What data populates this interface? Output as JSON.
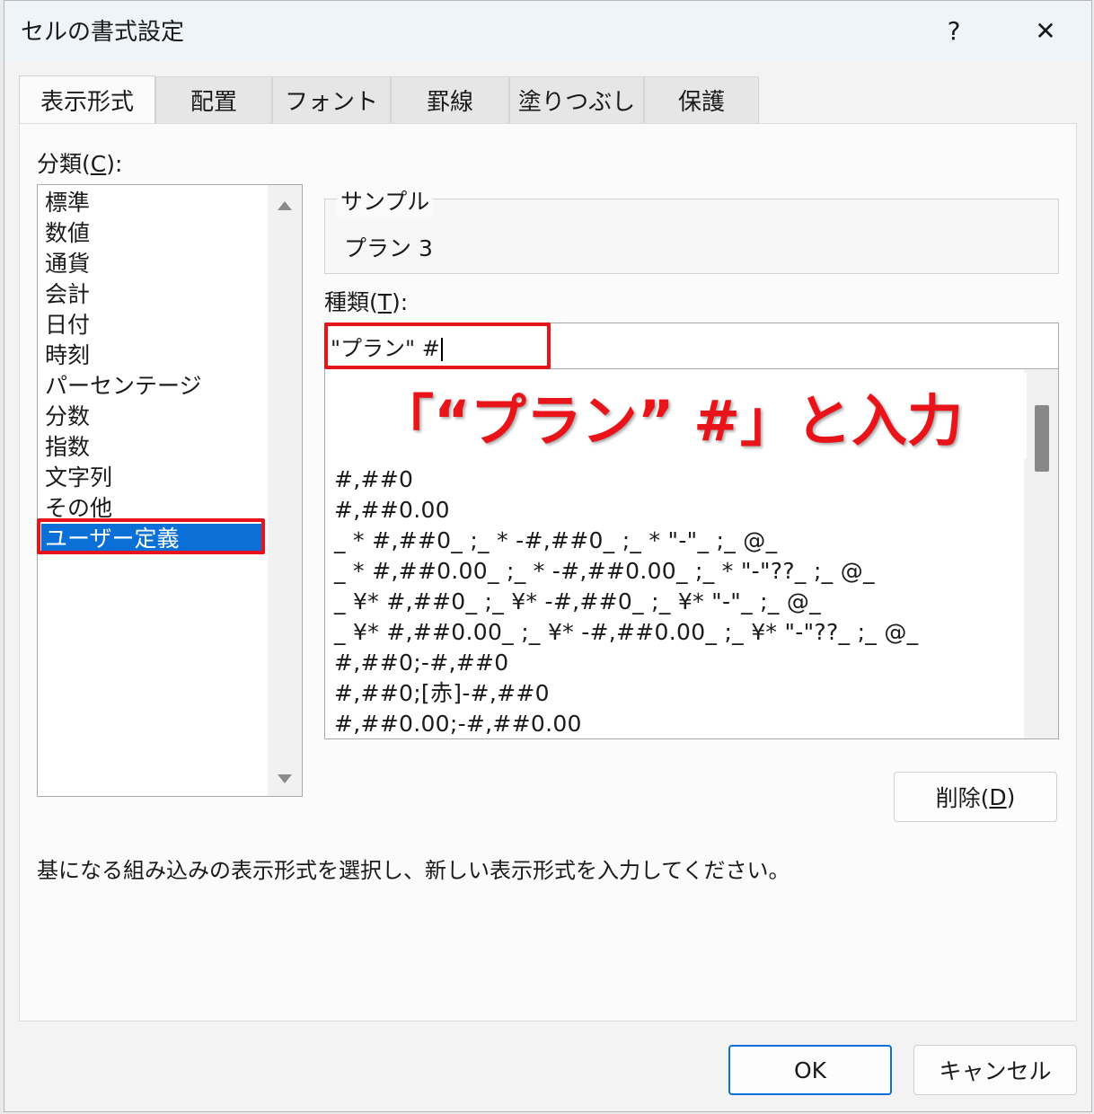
{
  "window": {
    "title": "セルの書式設定",
    "help": "?",
    "close": "✕"
  },
  "tabs": [
    {
      "label": "表示形式",
      "active": true
    },
    {
      "label": "配置"
    },
    {
      "label": "フォント"
    },
    {
      "label": "罫線"
    },
    {
      "label": "塗りつぶし"
    },
    {
      "label": "保護"
    }
  ],
  "category": {
    "label": "分類(",
    "accel": "C",
    "label_end": "):",
    "items": [
      "標準",
      "数値",
      "通貨",
      "会計",
      "日付",
      "時刻",
      "パーセンテージ",
      "分数",
      "指数",
      "文字列",
      "その他",
      "ユーザー定義"
    ],
    "selected": "ユーザー定義"
  },
  "sample": {
    "legend": "サンプル",
    "value": "プラン 3"
  },
  "type": {
    "label": "種類(",
    "accel": "T",
    "label_end": "):",
    "value": "\"プラン\" #",
    "formats": [
      "#,##0",
      "#,##0.00",
      "_ * #,##0_ ;_ * -#,##0_ ;_ * \"-\"_ ;_ @_",
      "_ * #,##0.00_ ;_ * -#,##0.00_ ;_ * \"-\"??_ ;_ @_",
      "_ ¥* #,##0_ ;_ ¥* -#,##0_ ;_ ¥* \"-\"_ ;_ @_",
      "_ ¥* #,##0.00_ ;_ ¥* -#,##0.00_ ;_ ¥* \"-\"??_ ;_ @_",
      "#,##0;-#,##0",
      "#,##0;[赤]-#,##0",
      "#,##0.00;-#,##0.00"
    ]
  },
  "annotation": "「“プラン” #」と入力",
  "buttons": {
    "delete": "削除(",
    "delete_accel": "D",
    "delete_end": ")",
    "ok": "OK",
    "cancel": "キャンセル"
  },
  "description": "基になる組み込みの表示形式を選択し、新しい表示形式を入力してください。",
  "colors": {
    "highlight": "#e8141a",
    "selection": "#0b6fd8"
  }
}
